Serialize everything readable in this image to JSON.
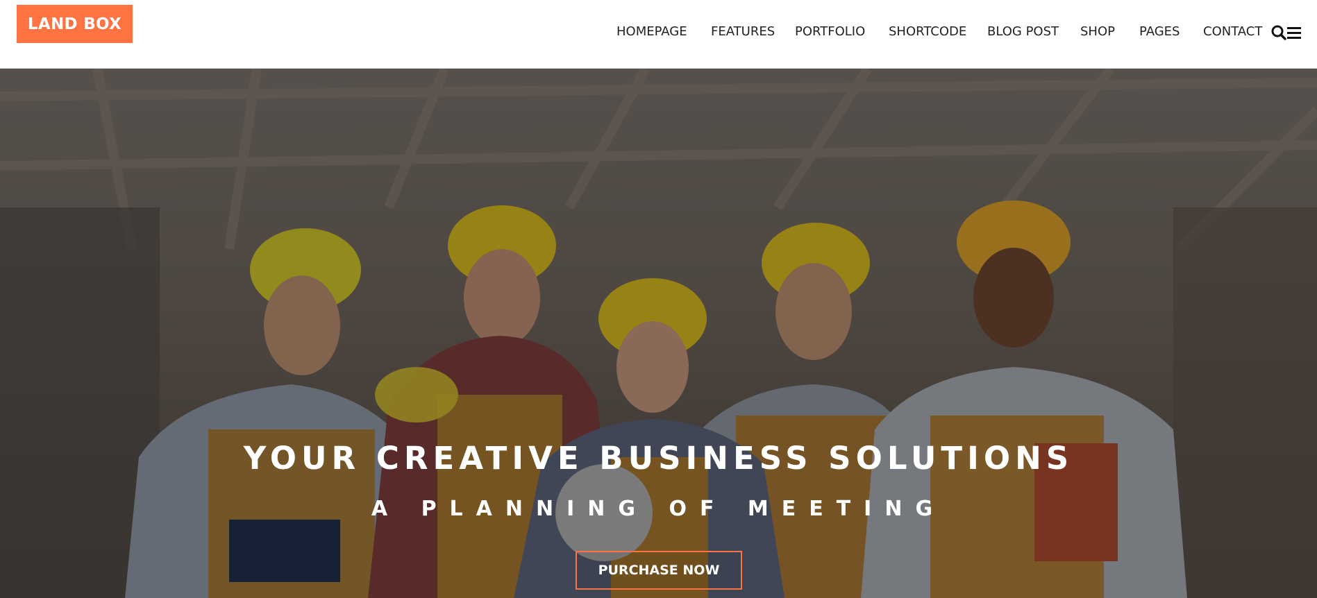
{
  "brand": {
    "logo_text": "LAND BOX",
    "accent_color": "#ff7342"
  },
  "nav": {
    "items": [
      {
        "label": "HOMEPAGE"
      },
      {
        "label": "FEATURES"
      },
      {
        "label": "PORTFOLIO"
      },
      {
        "label": "SHORTCODE"
      },
      {
        "label": "BLOG POST"
      },
      {
        "label": "SHOP"
      },
      {
        "label": "PAGES"
      },
      {
        "label": "CONTACT"
      }
    ],
    "icons": [
      "search-icon",
      "menu-icon"
    ]
  },
  "hero": {
    "title": "YOUR CREATIVE BUSINESS SOLUTIONS",
    "subtitle": "A PLANNING OF MEETING",
    "cta_label": "PURCHASE NOW",
    "image_subject": "five construction workers in yellow hard hats"
  }
}
